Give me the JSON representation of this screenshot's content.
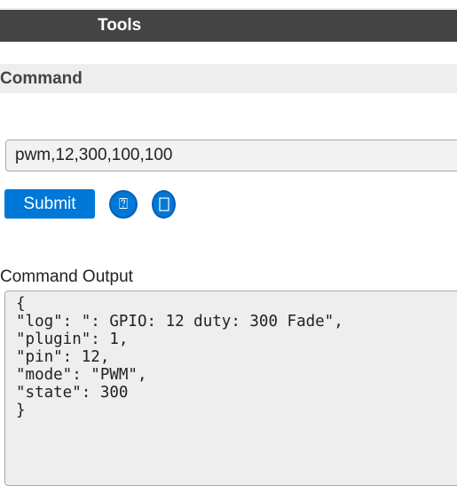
{
  "header": {
    "title": "Tools"
  },
  "command_section": {
    "title": "Command",
    "input_value": "pwm,12,300,100,100",
    "submit_label": "Submit",
    "help_icon": "question-circle-icon",
    "doc_icon": "document-icon"
  },
  "output_section": {
    "label": "Command Output",
    "text": "{\n\"log\": \": GPIO: 12 duty: 300 Fade\",\n\"plugin\": 1,\n\"pin\": 12,\n\"mode\": \"PWM\",\n\"state\": 300\n}"
  },
  "colors": {
    "header_bg": "#444444",
    "section_bg": "#eeeeee",
    "accent": "#0078d7"
  }
}
